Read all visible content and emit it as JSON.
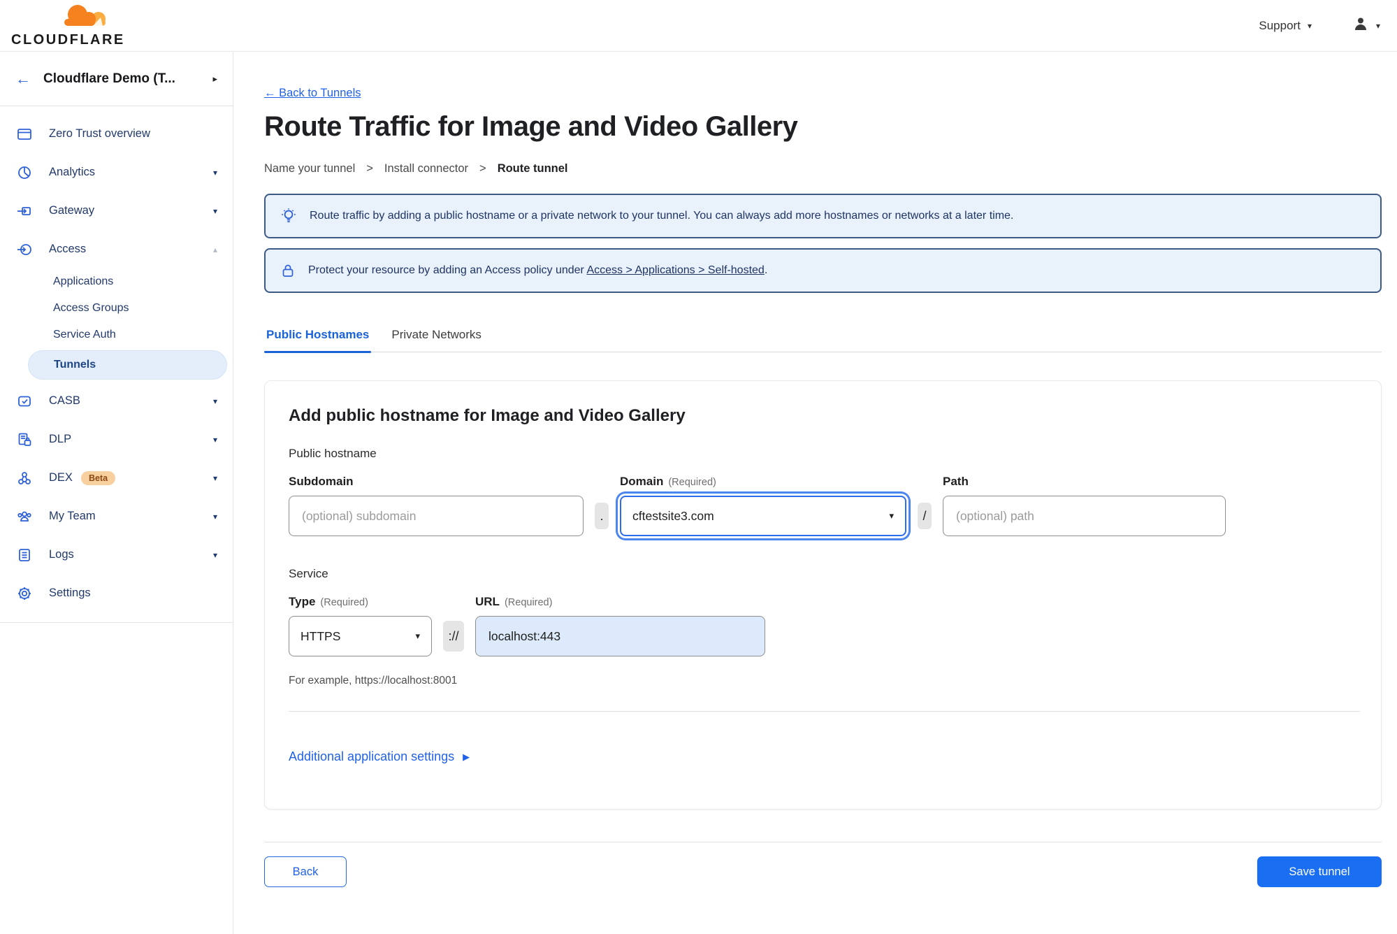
{
  "colors": {
    "accent": "#1a6ef2",
    "brand_orange": "#f6821f",
    "banner_bg": "#e9f1fb",
    "banner_border": "#3c5a85",
    "active_pill_bg": "#e4eefb"
  },
  "icons": {
    "arrow_left": "←",
    "caret_down": "▾",
    "caret_up": "▴",
    "caret_right": "▸",
    "play_right": "▶",
    "breadcrumb_sep": ">"
  },
  "topbar": {
    "brand": "CLOUDFLARE",
    "support_label": "Support"
  },
  "sidebar": {
    "team_name": "Cloudflare Demo (T...",
    "items": [
      {
        "label": "Zero Trust overview"
      },
      {
        "label": "Analytics"
      },
      {
        "label": "Gateway"
      },
      {
        "label": "Access"
      },
      {
        "label": "CASB"
      },
      {
        "label": "DLP"
      },
      {
        "label": "DEX",
        "badge": "Beta"
      },
      {
        "label": "My Team"
      },
      {
        "label": "Logs"
      },
      {
        "label": "Settings"
      }
    ],
    "access_children": [
      {
        "label": "Applications"
      },
      {
        "label": "Access Groups"
      },
      {
        "label": "Service Auth"
      },
      {
        "label": "Tunnels",
        "active": true
      }
    ]
  },
  "main": {
    "back_link": "← Back to Tunnels",
    "title": "Route Traffic for Image and Video Gallery",
    "breadcrumb": [
      {
        "label": "Name your tunnel"
      },
      {
        "label": "Install connector"
      },
      {
        "label": "Route tunnel"
      }
    ],
    "banners": [
      {
        "text": "Route traffic by adding a public hostname or a private network to your tunnel. You can always add more hostnames or networks at a later time."
      },
      {
        "text_before": "Protect your resource by adding an Access policy under ",
        "link": "Access > Applications > Self-hosted",
        "text_after": "."
      }
    ],
    "tabs": [
      {
        "label": "Public Hostnames"
      },
      {
        "label": "Private Networks"
      }
    ],
    "card": {
      "heading": "Add public hostname for Image and Video Gallery",
      "hostname_section_label": "Public hostname",
      "subdomain": {
        "label": "Subdomain",
        "placeholder": "(optional) subdomain"
      },
      "domain": {
        "label": "Domain",
        "required": "(Required)",
        "value": "cftestsite3.com"
      },
      "path": {
        "label": "Path",
        "placeholder": "(optional) path"
      },
      "dot_separator": ".",
      "slash_separator": "/",
      "service_section_label": "Service",
      "type": {
        "label": "Type",
        "required": "(Required)",
        "value": "HTTPS"
      },
      "scheme_separator": "://",
      "url": {
        "label": "URL",
        "required": "(Required)",
        "value": "localhost:443"
      },
      "example_hint": "For example, https://localhost:8001",
      "additional_settings_label": "Additional application settings"
    },
    "footer": {
      "back_label": "Back",
      "save_label": "Save tunnel"
    }
  }
}
